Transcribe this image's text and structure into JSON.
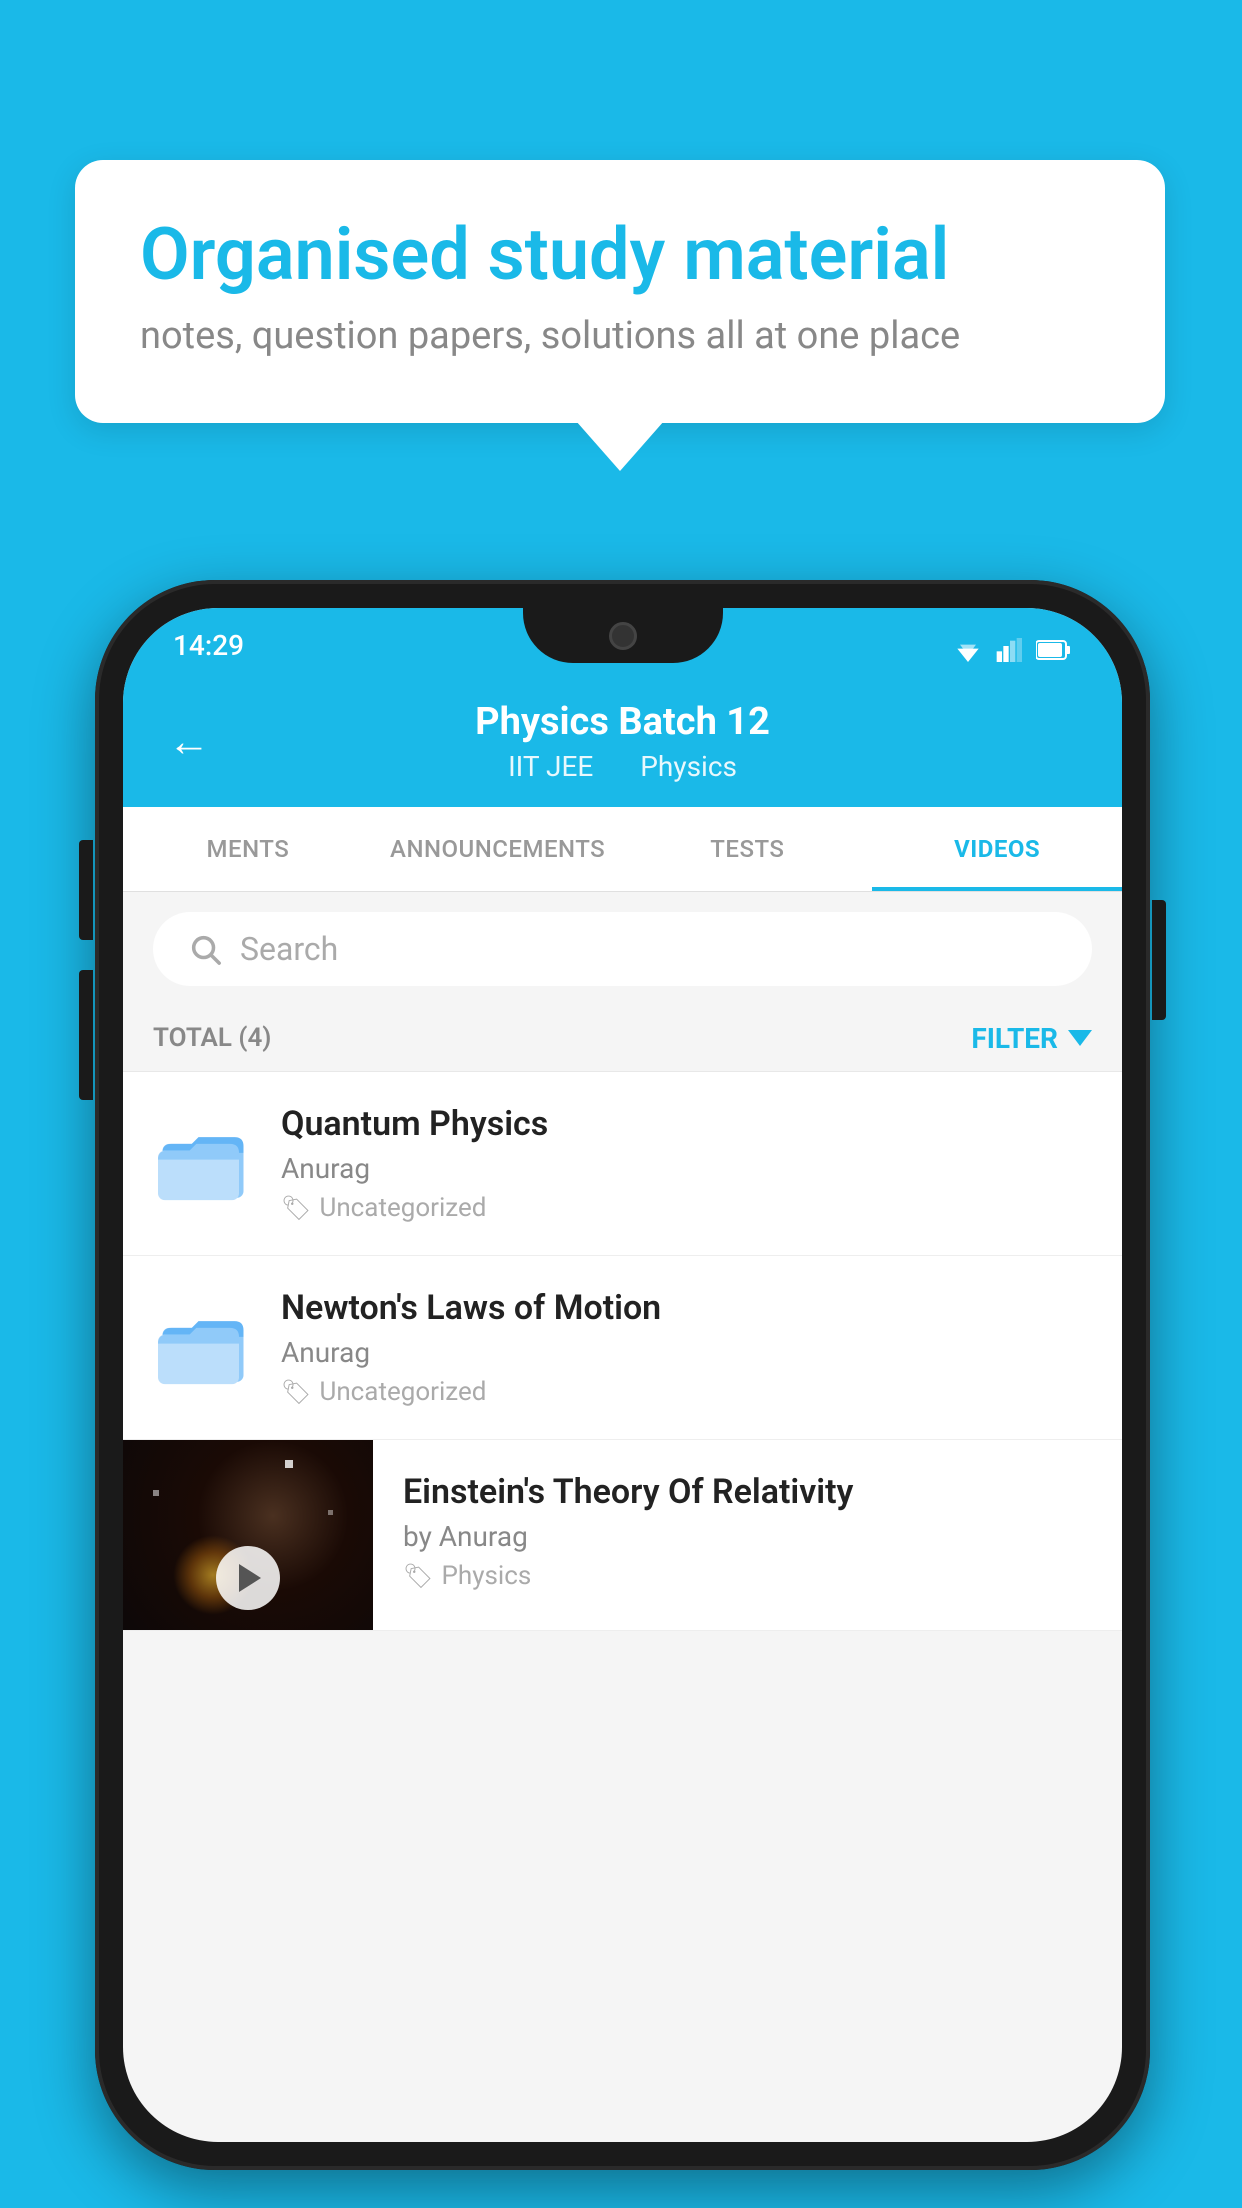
{
  "background_color": "#1ab9e8",
  "bubble": {
    "title": "Organised study material",
    "subtitle": "notes, question papers, solutions all at one place"
  },
  "phone": {
    "status_bar": {
      "time": "14:29"
    },
    "header": {
      "back_label": "←",
      "title": "Physics Batch 12",
      "subtitle_part1": "IIT JEE",
      "subtitle_part2": "Physics"
    },
    "tabs": [
      {
        "label": "MENTS",
        "active": false
      },
      {
        "label": "ANNOUNCEMENTS",
        "active": false
      },
      {
        "label": "TESTS",
        "active": false
      },
      {
        "label": "VIDEOS",
        "active": true
      }
    ],
    "search": {
      "placeholder": "Search"
    },
    "filter_row": {
      "total_label": "TOTAL (4)",
      "filter_label": "FILTER"
    },
    "video_items": [
      {
        "title": "Quantum Physics",
        "author": "Anurag",
        "tag": "Uncategorized",
        "has_thumbnail": false
      },
      {
        "title": "Newton's Laws of Motion",
        "author": "Anurag",
        "tag": "Uncategorized",
        "has_thumbnail": false
      },
      {
        "title": "Einstein's Theory Of Relativity",
        "author": "by Anurag",
        "tag": "Physics",
        "has_thumbnail": true
      }
    ]
  }
}
